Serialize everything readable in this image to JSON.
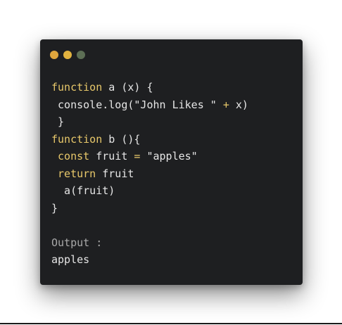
{
  "window": {
    "dots": [
      {
        "name": "close",
        "color": "#e0a63d"
      },
      {
        "name": "minimize",
        "color": "#e2b33f"
      },
      {
        "name": "maximize",
        "color": "#5d6f55"
      }
    ]
  },
  "code": {
    "lines": [
      [
        {
          "t": "function",
          "c": "kw"
        },
        {
          "t": " a (x) {",
          "c": "plain"
        }
      ],
      [
        {
          "t": " console.log(\"John Likes \" ",
          "c": "plain"
        },
        {
          "t": "+",
          "c": "op"
        },
        {
          "t": " x)",
          "c": "plain"
        }
      ],
      [
        {
          "t": " }",
          "c": "plain"
        }
      ],
      [
        {
          "t": "function",
          "c": "kw"
        },
        {
          "t": " b (){",
          "c": "plain"
        }
      ],
      [
        {
          "t": " ",
          "c": "plain"
        },
        {
          "t": "const",
          "c": "kw"
        },
        {
          "t": " fruit ",
          "c": "plain"
        },
        {
          "t": "=",
          "c": "op"
        },
        {
          "t": " \"apples\"",
          "c": "plain"
        }
      ],
      [
        {
          "t": " ",
          "c": "plain"
        },
        {
          "t": "return",
          "c": "kw"
        },
        {
          "t": " fruit",
          "c": "plain"
        }
      ],
      [
        {
          "t": "  a(fruit)",
          "c": "plain"
        }
      ],
      [
        {
          "t": "}",
          "c": "plain"
        }
      ],
      [
        {
          "t": "",
          "c": "plain"
        }
      ],
      [
        {
          "t": "Output :",
          "c": "output-label"
        }
      ],
      [
        {
          "t": "apples",
          "c": "output-value"
        }
      ]
    ]
  }
}
